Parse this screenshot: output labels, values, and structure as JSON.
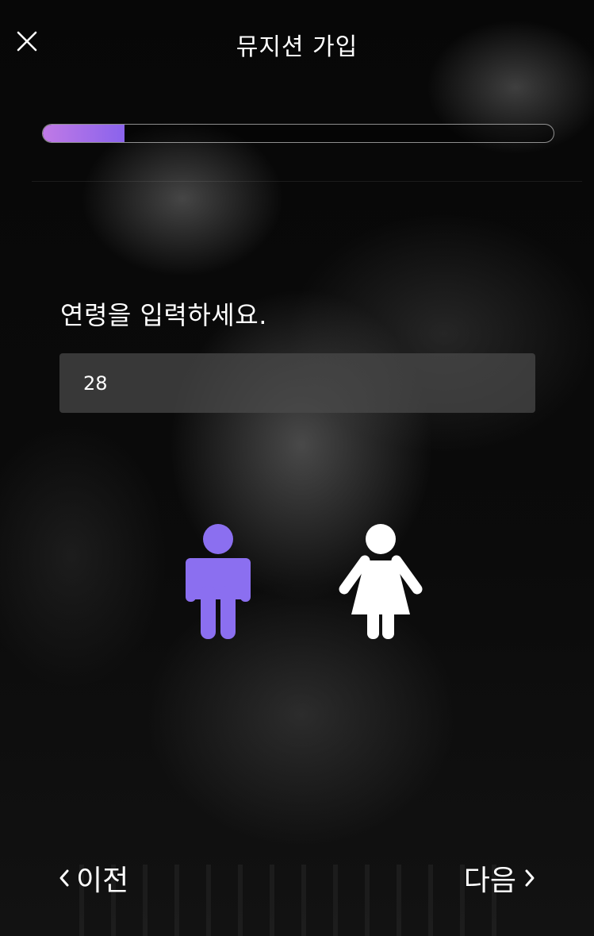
{
  "header": {
    "title": "뮤지션 가입",
    "close_icon": "close-icon"
  },
  "progress": {
    "fraction": 0.16,
    "fill_color_start": "#c07ae6",
    "fill_color_end": "#8a63ec"
  },
  "form": {
    "age_prompt": "연령을 입력하세요.",
    "age_value": "28",
    "gender_options": [
      {
        "name": "male",
        "icon": "male-figure-icon",
        "selected": true,
        "color": "#8b6ff0"
      },
      {
        "name": "female",
        "icon": "female-figure-icon",
        "selected": false,
        "color": "#ffffff"
      }
    ]
  },
  "footer": {
    "prev_label": "이전",
    "next_label": "다음",
    "prev_icon": "chevron-left-icon",
    "next_icon": "chevron-right-icon"
  }
}
